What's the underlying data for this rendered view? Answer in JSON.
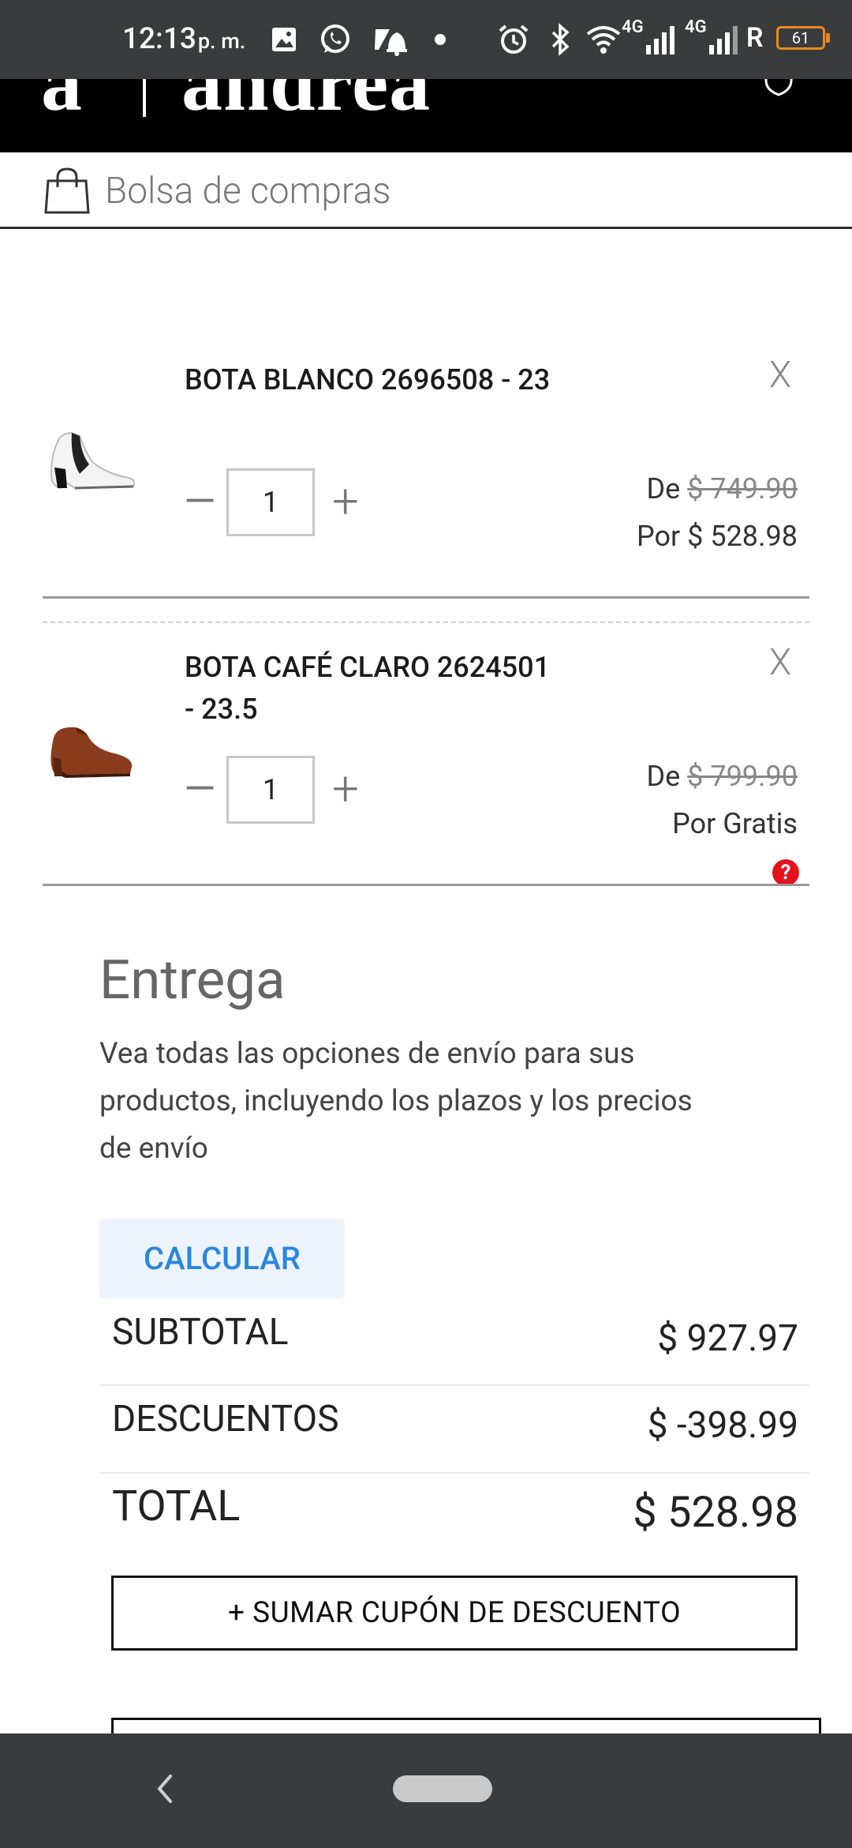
{
  "status_bar": {
    "time": "12:13",
    "ampm": "p. m.",
    "network_1": "4G",
    "network_2": "4G",
    "roaming": "R",
    "battery": "61",
    "icons": [
      "image-icon",
      "whatsapp-icon",
      "notification-off-icon",
      "dot-icon",
      "alarm-icon",
      "bluetooth-icon",
      "wifi-icon",
      "signal-icon",
      "signal-icon"
    ]
  },
  "header": {
    "logo_mark": "a",
    "logo_text": "andrea",
    "icon": "user-shield-icon"
  },
  "cart": {
    "title": "Bolsa de compras",
    "items": [
      {
        "name": "BOTA BLANCO 2696508 - 23",
        "quantity": "1",
        "price_from_label": "De",
        "price_from": "$ 749.90",
        "price_to": "Por $ 528.98",
        "remove_label": "X",
        "image_icon": "white-bootie-image"
      },
      {
        "name": "BOTA CAFÉ CLARO 2624501 - 23.5",
        "quantity": "1",
        "price_from_label": "De",
        "price_from": "$ 799.90",
        "price_to": "Por Gratis",
        "remove_label": "X",
        "image_icon": "brown-bootie-image",
        "help": "?"
      }
    ],
    "minus_label": "—",
    "plus_label": "+"
  },
  "delivery": {
    "title": "Entrega",
    "description": "Vea todas las opciones de envío para sus productos, incluyendo los plazos y los precios de envío",
    "calculate_label": "CALCULAR"
  },
  "totals": {
    "subtotal_label": "SUBTOTAL",
    "subtotal_value": "$ 927.97",
    "discounts_label": "DESCUENTOS",
    "discounts_value": "$ -398.99",
    "total_label": "TOTAL",
    "total_value": "$ 528.98"
  },
  "coupon_label": "+ SUMAR CUPÓN DE DESCUENTO",
  "colors": {
    "accent_blue": "#2a86e0",
    "help_red": "#e4131b",
    "battery_orange": "#e98a1f",
    "system_bar": "#3a3b3d"
  }
}
